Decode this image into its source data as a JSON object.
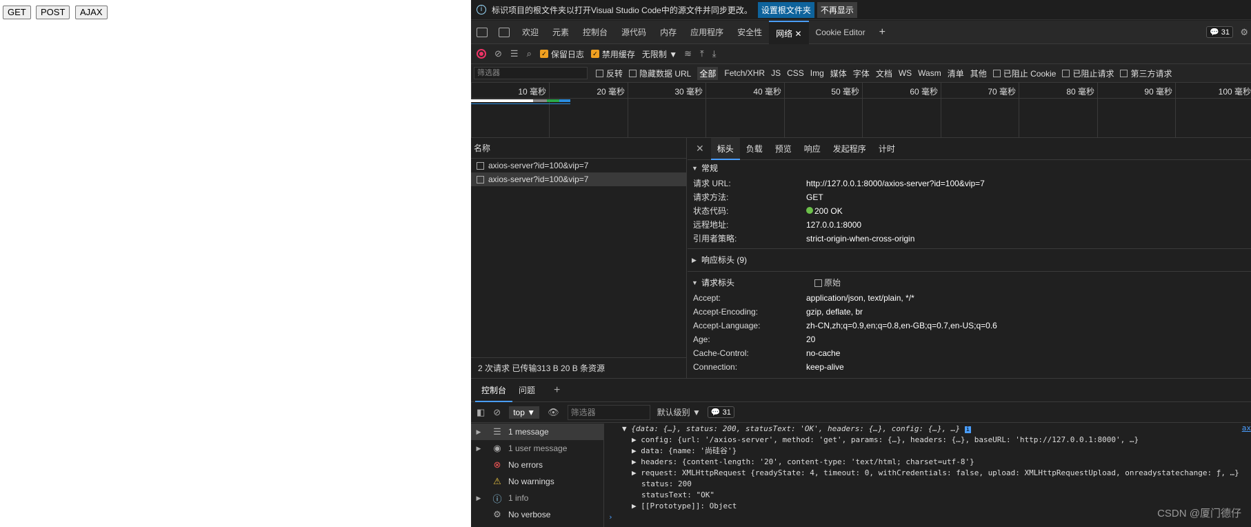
{
  "page": {
    "buttons": [
      "GET",
      "POST",
      "AJAX"
    ]
  },
  "infobar": {
    "text": "标识项目的根文件夹以打开Visual Studio Code中的源文件并同步更改。",
    "btn1": "设置根文件夹",
    "btn2": "不再显示"
  },
  "tabs": {
    "items": [
      "欢迎",
      "元素",
      "控制台",
      "源代码",
      "内存",
      "应用程序",
      "安全性",
      "网络",
      "Cookie Editor"
    ],
    "active": "网络",
    "badge": "31"
  },
  "toolbar": {
    "preserve_log": "保留日志",
    "disable_cache": "禁用缓存",
    "throttle": "无限制"
  },
  "filterbar": {
    "placeholder": "筛选器",
    "invert": "反转",
    "hide_data": "隐藏数据 URL",
    "types": [
      "全部",
      "Fetch/XHR",
      "JS",
      "CSS",
      "Img",
      "媒体",
      "字体",
      "文档",
      "WS",
      "Wasm",
      "清单",
      "其他"
    ],
    "blocked_cookies": "已阻止 Cookie",
    "blocked_requests": "已阻止请求",
    "third_party": "第三方请求"
  },
  "timeline": {
    "ticks": [
      "10 毫秒",
      "20 毫秒",
      "30 毫秒",
      "40 毫秒",
      "50 毫秒",
      "60 毫秒",
      "70 毫秒",
      "80 毫秒",
      "90 毫秒",
      "100 毫秒"
    ]
  },
  "requests": {
    "header": "名称",
    "rows": [
      "axios-server?id=100&vip=7",
      "axios-server?id=100&vip=7"
    ],
    "status": "2 次请求  已传输313 B  20 B 条资源"
  },
  "details": {
    "tabs": [
      "标头",
      "负载",
      "预览",
      "响应",
      "发起程序",
      "计时"
    ],
    "general_title": "常规",
    "general": [
      [
        "请求 URL:",
        "http://127.0.0.1:8000/axios-server?id=100&vip=7"
      ],
      [
        "请求方法:",
        "GET"
      ],
      [
        "状态代码:",
        "200 OK"
      ],
      [
        "远程地址:",
        "127.0.0.1:8000"
      ],
      [
        "引用者策略:",
        "strict-origin-when-cross-origin"
      ]
    ],
    "resp_headers": "响应标头 (9)",
    "req_headers": "请求标头",
    "raw": "原始",
    "req": [
      [
        "Accept:",
        "application/json, text/plain, */*"
      ],
      [
        "Accept-Encoding:",
        "gzip, deflate, br"
      ],
      [
        "Accept-Language:",
        "zh-CN,zh;q=0.9,en;q=0.8,en-GB;q=0.7,en-US;q=0.6"
      ],
      [
        "Age:",
        "20"
      ],
      [
        "Cache-Control:",
        "no-cache"
      ],
      [
        "Connection:",
        "keep-alive"
      ]
    ]
  },
  "console": {
    "tabs": [
      "控制台",
      "问题"
    ],
    "context": "top",
    "filter": "筛选器",
    "level": "默认级别",
    "count": "31",
    "sidebar": [
      "1 message",
      "1 user message",
      "No errors",
      "No warnings",
      "1 info",
      "No verbose"
    ],
    "lines": [
      "{data: {…}, status: 200, statusText: 'OK', headers: {…}, config: {…}, …}",
      "config: {url: '/axios-server', method: 'get', params: {…}, headers: {…}, baseURL: 'http://127.0.0.1:8000', …}",
      "data: {name: '尚硅谷'}",
      "headers: {content-length: '20', content-type: 'text/html; charset=utf-8'}",
      "request: XMLHttpRequest {readyState: 4, timeout: 0, withCredentials: false, upload: XMLHttpRequestUpload, onreadystatechange: ƒ, …}",
      "status: 200",
      "statusText: \"OK\"",
      "[[Prototype]]: Object"
    ],
    "link": "ax"
  },
  "watermark": "CSDN @厦门德仔"
}
